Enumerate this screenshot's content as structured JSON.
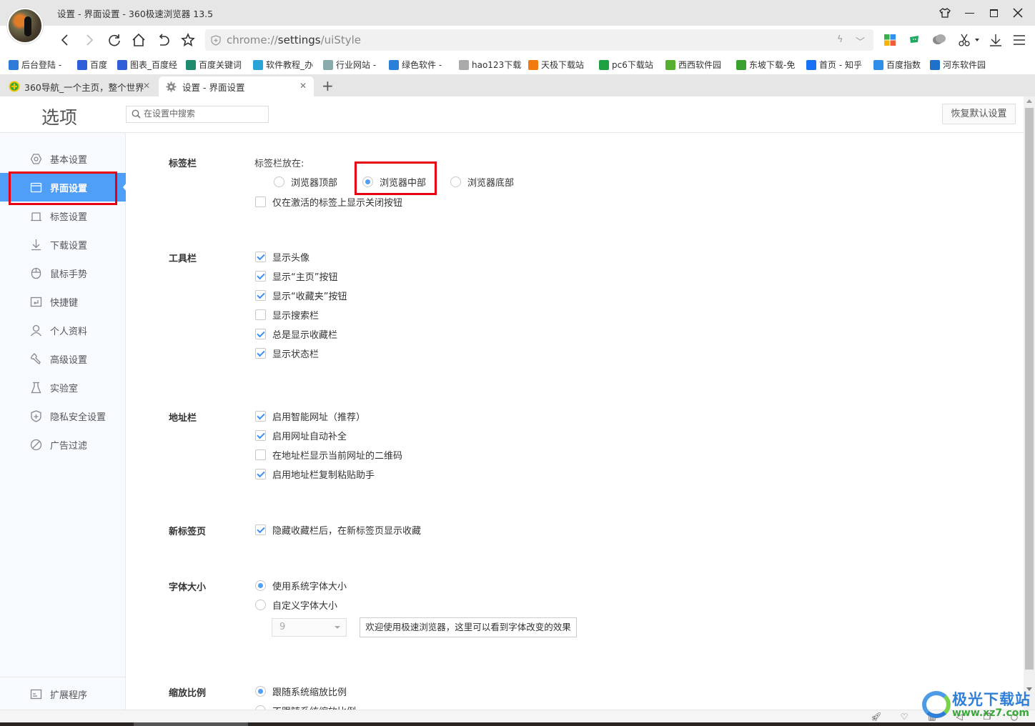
{
  "window": {
    "title": "设置 - 界面设置 - 360极速浏览器 13.5",
    "controls": {
      "skin": "skin-icon",
      "minimize": "—",
      "maximize": "☐",
      "close": "✕"
    }
  },
  "navbar": {
    "url_prefix": "chrome://",
    "url_host": "settings",
    "url_path": "/uiStyle"
  },
  "bookmarks": [
    {
      "label": "后台登陆 -",
      "icon": "swirl-icon",
      "color": "#2e7ad8"
    },
    {
      "label": "百度",
      "icon": "baidu-paw-icon",
      "color": "#2f5fd8"
    },
    {
      "label": "图表_百度经",
      "icon": "baidu-paw-icon",
      "color": "#2f5fd8"
    },
    {
      "label": "百度关键词",
      "icon": "square-logo-icon",
      "color": "#1e8a6e"
    },
    {
      "label": "软件教程_办",
      "icon": "cap-icon",
      "color": "#2aa3d8"
    },
    {
      "label": "行业网站 -",
      "icon": "doc-icon",
      "color": "#8aa"
    },
    {
      "label": "绿色软件 -",
      "icon": "y-logo-icon",
      "color": "#2a7fd8"
    },
    {
      "label": "hao123下载",
      "icon": "page-icon",
      "color": "#aaa"
    },
    {
      "label": "天极下载站",
      "icon": "e-logo-icon",
      "color": "#f07a10"
    },
    {
      "label": "pc6下载站",
      "icon": "pc6-logo-icon",
      "color": "#1fa040"
    },
    {
      "label": "西西软件园",
      "icon": "g-logo-icon",
      "color": "#55b030"
    },
    {
      "label": "东坡下载-免",
      "icon": "d-logo-icon",
      "color": "#3aa030"
    },
    {
      "label": "首页 - 知乎",
      "icon": "zhihu-icon",
      "color": "#1772f6"
    },
    {
      "label": "百度指数",
      "icon": "baidu-paw-icon",
      "color": "#2f8fe8"
    },
    {
      "label": "河东软件园",
      "icon": "hedong-logo-icon",
      "color": "#1e70c8"
    }
  ],
  "tabs": [
    {
      "label": "360导航_一个主页，整个世界",
      "active": false
    },
    {
      "label": "设置 - 界面设置",
      "active": true
    }
  ],
  "header": {
    "title": "选项",
    "search_placeholder": "在设置中搜索",
    "restore_label": "恢复默认设置"
  },
  "sidebar": {
    "items": [
      {
        "label": "基本设置",
        "icon": "gear-hex-icon",
        "active": false
      },
      {
        "label": "界面设置",
        "icon": "window-icon",
        "active": true
      },
      {
        "label": "标签设置",
        "icon": "tab-icon",
        "active": false
      },
      {
        "label": "下载设置",
        "icon": "download-icon",
        "active": false
      },
      {
        "label": "鼠标手势",
        "icon": "mouse-icon",
        "active": false
      },
      {
        "label": "快捷键",
        "icon": "shortcut-icon",
        "active": false
      },
      {
        "label": "个人资料",
        "icon": "user-icon",
        "active": false
      },
      {
        "label": "高级设置",
        "icon": "wrench-icon",
        "active": false
      },
      {
        "label": "实验室",
        "icon": "flask-icon",
        "active": false
      },
      {
        "label": "隐私安全设置",
        "icon": "shield-plus-icon",
        "active": false
      },
      {
        "label": "广告过滤",
        "icon": "block-icon",
        "active": false
      }
    ],
    "extensions_label": "扩展程序"
  },
  "sections": {
    "tabbar": {
      "title": "标签栏",
      "position_label": "标签栏放在:",
      "radios": [
        {
          "label": "浏览器顶部",
          "checked": false
        },
        {
          "label": "浏览器中部",
          "checked": true
        },
        {
          "label": "浏览器底部",
          "checked": false
        }
      ],
      "close_on_active": {
        "label": "仅在激活的标签上显示关闭按钮",
        "checked": false
      }
    },
    "toolbar": {
      "title": "工具栏",
      "options": [
        {
          "label": "显示头像",
          "checked": true
        },
        {
          "label": "显示“主页”按钮",
          "checked": true
        },
        {
          "label": "显示“收藏夹”按钮",
          "checked": true
        },
        {
          "label": "显示搜索栏",
          "checked": false
        },
        {
          "label": "总是显示收藏栏",
          "checked": true
        },
        {
          "label": "显示状态栏",
          "checked": true
        }
      ]
    },
    "addressbar": {
      "title": "地址栏",
      "options": [
        {
          "label": "启用智能网址（推荐）",
          "checked": true
        },
        {
          "label": "启用网址自动补全",
          "checked": true
        },
        {
          "label": "在地址栏显示当前网址的二维码",
          "checked": false
        },
        {
          "label": "启用地址栏复制粘贴助手",
          "checked": true
        }
      ]
    },
    "newtab": {
      "title": "新标签页",
      "options": [
        {
          "label": "隐藏收藏栏后，在新标签页显示收藏",
          "checked": true
        }
      ]
    },
    "fontsize": {
      "title": "字体大小",
      "radios": [
        {
          "label": "使用系统字体大小",
          "checked": true
        },
        {
          "label": "自定义字体大小",
          "checked": false
        }
      ],
      "size_value": "9",
      "preview_text": "欢迎使用极速浏览器，这里可以看到字体改变的效果"
    },
    "zoom": {
      "title": "缩放比例",
      "radios": [
        {
          "label": "跟随系统缩放比例",
          "checked": true
        },
        {
          "label": "不跟随系统缩放比例",
          "checked": false
        }
      ]
    }
  },
  "watermark": {
    "title": "极光下载站",
    "url": "www.xz7.com"
  }
}
